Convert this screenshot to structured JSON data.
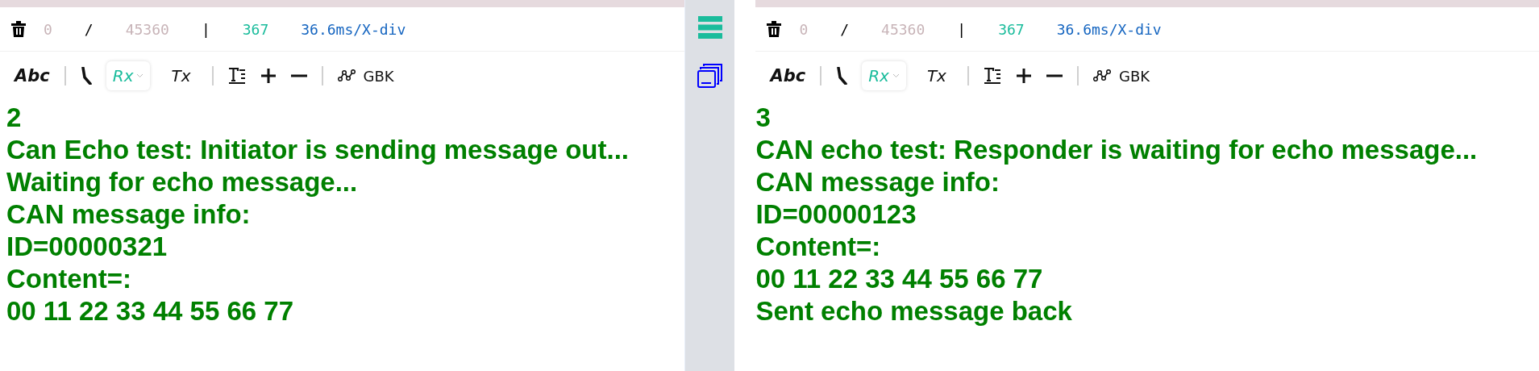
{
  "panels": [
    {
      "status": {
        "count": "0",
        "separator": "/",
        "total": "45360",
        "divider": "|",
        "rate": "367",
        "scale": "36.6ms/X-div"
      },
      "toolbar": {
        "format": "Abc",
        "modes": [
          {
            "label": "Rx",
            "selected": true
          },
          {
            "label": "Tx",
            "selected": false
          }
        ],
        "encoding": "GBK"
      },
      "lines": [
        "2",
        "Can Echo test: Initiator is sending message out...",
        "Waiting for echo message...",
        "CAN message info:",
        "ID=00000321",
        "Content=:",
        "00 11 22 33 44 55 66 77"
      ]
    },
    {
      "status": {
        "count": "0",
        "separator": "/",
        "total": "45360",
        "divider": "|",
        "rate": "367",
        "scale": "36.6ms/X-div"
      },
      "toolbar": {
        "format": "Abc",
        "modes": [
          {
            "label": "Rx",
            "selected": true
          },
          {
            "label": "Tx",
            "selected": false
          }
        ],
        "encoding": "GBK"
      },
      "lines": [
        "3",
        "CAN echo test: Responder is waiting for echo message...",
        "CAN message info:",
        "ID=00000123",
        "Content=:",
        "00 11 22 33 44 55 66 77",
        "Sent echo message back"
      ]
    }
  ]
}
